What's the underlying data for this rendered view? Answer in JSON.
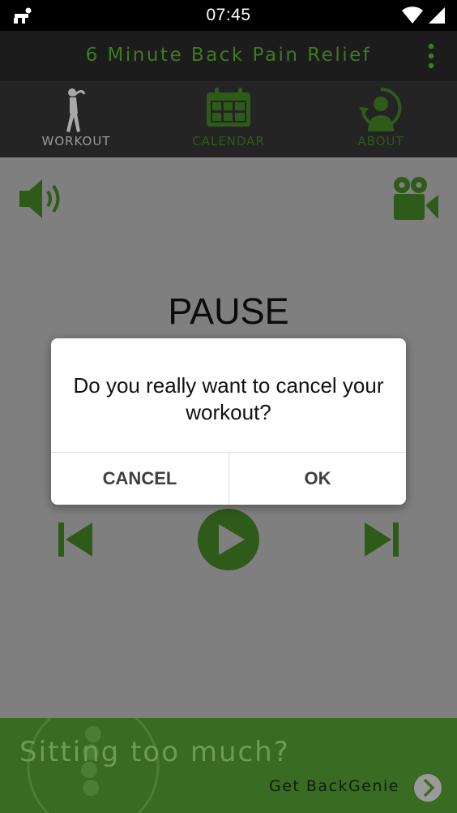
{
  "status_bar": {
    "time": "07:45"
  },
  "app_bar": {
    "title": "6 Minute Back Pain Relief",
    "menu_icon": "overflow-menu-icon"
  },
  "tabs": [
    {
      "label": "WORKOUT",
      "icon": "stretching-person-icon",
      "active": true
    },
    {
      "label": "CALENDAR",
      "icon": "calendar-icon",
      "active": false
    },
    {
      "label": "ABOUT",
      "icon": "person-refresh-icon",
      "active": false
    }
  ],
  "player": {
    "state_label": "PAUSE",
    "sound_icon": "speaker-icon",
    "video_icon": "video-camera-icon",
    "prev_icon": "skip-previous-icon",
    "play_icon": "play-icon",
    "next_icon": "skip-next-icon"
  },
  "banner": {
    "title": "Sitting too much?",
    "subtitle": "Get BackGenie",
    "arrow_icon": "chevron-right-icon"
  },
  "dialog": {
    "message": "Do you really want to cancel your workout?",
    "cancel_label": "CANCEL",
    "ok_label": "OK"
  },
  "colors": {
    "accent_green": "#3d7a22",
    "dark_green": "#2e5a1a",
    "overlay_gray": "#7f7f7f",
    "banner_green": "#3a6b22"
  }
}
